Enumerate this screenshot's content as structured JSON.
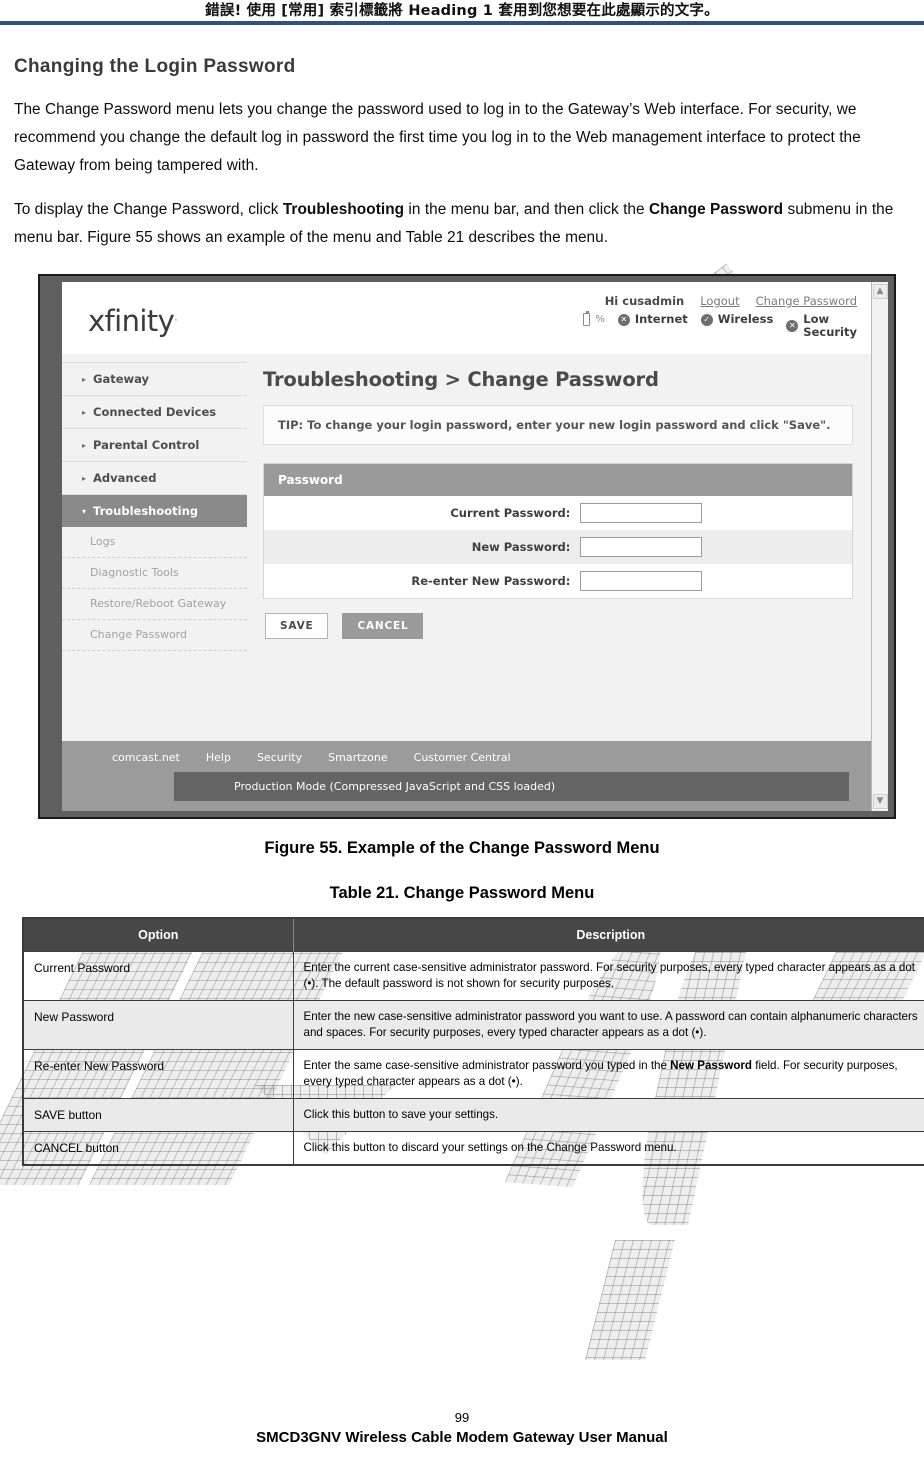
{
  "header": {
    "running_head": "錯誤! 使用 [常用] 索引標籤將 Heading 1 套用到您想要在此處顯示的文字。"
  },
  "section": {
    "title": "Changing the Login Password",
    "paragraph1": "The Change Password menu lets you change the password used to log in to the Gateway’s Web interface. For security, we recommend you change the default log in password the first time you log in to the Web management interface to protect the Gateway from being tampered with.",
    "paragraph2_a": "To display the Change Password, click ",
    "paragraph2_b": "Troubleshooting",
    "paragraph2_c": " in the menu bar, and then click the ",
    "paragraph2_d": "Change Password",
    "paragraph2_e": " submenu in the menu bar. Figure 55 shows an example of the menu and Table 21 describes the menu."
  },
  "screenshot": {
    "logo": "xfinity",
    "logo_tm": ".",
    "account": {
      "greeting": "Hi cusadmin",
      "logout": "Logout",
      "change_password": "Change Password"
    },
    "status": {
      "battery_pct": "%",
      "internet": "Internet",
      "wireless": "Wireless",
      "security_line1": "Low",
      "security_line2": "Security"
    },
    "sidebar": {
      "items": [
        {
          "label": "Gateway",
          "caret": "▸",
          "active": false
        },
        {
          "label": "Connected Devices",
          "caret": "▸",
          "active": false
        },
        {
          "label": "Parental Control",
          "caret": "▸",
          "active": false
        },
        {
          "label": "Advanced",
          "caret": "▸",
          "active": false
        },
        {
          "label": "Troubleshooting",
          "caret": "▾",
          "active": true
        }
      ],
      "subitems": [
        {
          "label": "Logs"
        },
        {
          "label": "Diagnostic Tools"
        },
        {
          "label": "Restore/Reboot Gateway"
        },
        {
          "label": "Change Password"
        }
      ]
    },
    "breadcrumb": "Troubleshooting > Change Password",
    "tip": "TIP: To change your login password, enter your new login password and click \"Save\".",
    "panel_title": "Password",
    "fields": [
      {
        "label": "Current Password:",
        "value": ""
      },
      {
        "label": "New Password:",
        "value": ""
      },
      {
        "label": "Re-enter New Password:",
        "value": ""
      }
    ],
    "buttons": {
      "save": "SAVE",
      "cancel": "CANCEL"
    },
    "footer_links": [
      "comcast.net",
      "Help",
      "Security",
      "Smartzone",
      "Customer Central"
    ],
    "production_mode": "Production Mode (Compressed JavaScript and CSS loaded)",
    "scrollbar": {
      "up": "▲",
      "down": "▼"
    }
  },
  "figure_caption": "Figure 55. Example of the Change Password Menu",
  "table_title": "Table 21. Change Password Menu",
  "table": {
    "headers": [
      "Option",
      "Description"
    ],
    "rows": [
      {
        "option": "Current Password",
        "description": "Enter the current case-sensitive administrator password. For security purposes, every typed character appears as a dot (•). The default password is not shown for security purposes.",
        "shaded": false
      },
      {
        "option": "New Password",
        "description": "Enter the new case-sensitive administrator password you want to use. A password can contain alphanumeric characters and spaces. For security purposes, every typed character appears as a dot (•).",
        "shaded": true
      },
      {
        "option": "Re-enter New Password",
        "description_a": "Enter the same case-sensitive administrator password you typed in the ",
        "description_b": "New Password",
        "description_c": " field. For security purposes, every typed character appears as a dot (•).",
        "shaded": false
      },
      {
        "option": "SAVE button",
        "description": "Click this button to save your settings.",
        "shaded": true
      },
      {
        "option": "CANCEL button",
        "description": "Click this button to discard your settings on the Change Password menu.",
        "shaded": false
      }
    ]
  },
  "footer": {
    "page_number": "99",
    "manual_title": "SMCD3GNV Wireless Cable Modem Gateway User Manual"
  },
  "colors": {
    "header_rule": "#2b5580",
    "table_header_bg": "#474747",
    "active_menu_bg": "#8a8a8a"
  }
}
